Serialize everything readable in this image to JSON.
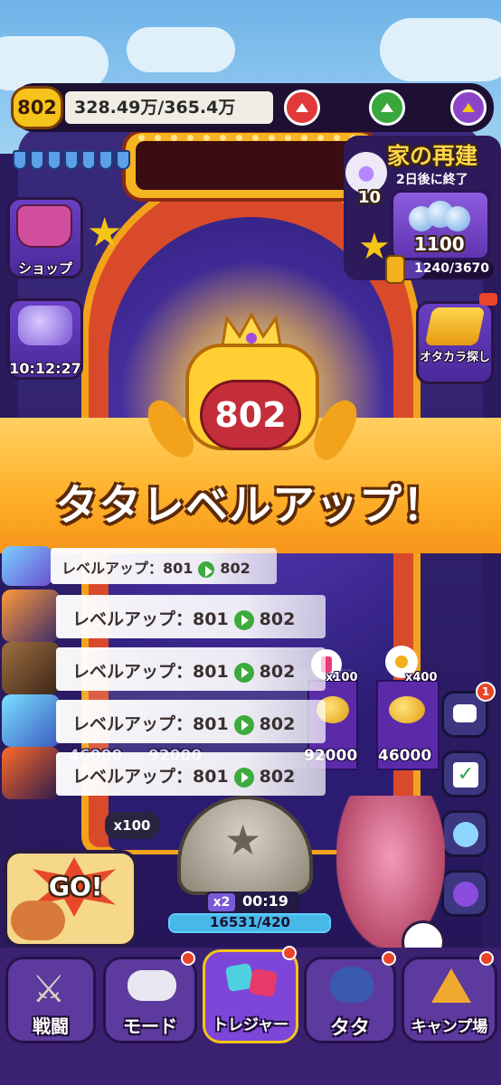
{
  "top_bar": {
    "player_level": "802",
    "exp": "328.49万/365.4万"
  },
  "event": {
    "title": "家の再建",
    "subtitle": "2日後に終了",
    "paw_count": "10",
    "reward_value": "1100",
    "progress": "1240/3670"
  },
  "left_buttons": {
    "shop_label": "ショップ",
    "timer": "10:12:27"
  },
  "right_buttons": {
    "treasure_label": "オタカラ探し"
  },
  "level_up": {
    "level": "802",
    "title": "タタレベルアップ！"
  },
  "notifications": [
    {
      "prefix": "レベルアップ：801",
      "to": "802"
    },
    {
      "prefix": "レベルアップ：801",
      "to": "802"
    },
    {
      "prefix": "レベルアップ：801",
      "to": "802"
    },
    {
      "prefix": "レベルアップ：801",
      "to": "802"
    },
    {
      "prefix": "レベルアップ：801",
      "to": "802"
    }
  ],
  "slots": {
    "left_val_1": "46000",
    "left_val_2": "92000",
    "slot3_val": "92000",
    "slot4_val": "46000",
    "slot3_mult": "x100",
    "slot4_mult": "x400"
  },
  "plunger": {
    "multiplier": "x100",
    "ball_mult": "x2",
    "timer": "00:19",
    "counter": "16531/420"
  },
  "go_label": "GO!",
  "chat_badge": "1",
  "bottom_nav": [
    {
      "label": "戦闘"
    },
    {
      "label": "モード"
    },
    {
      "label": "トレジャー"
    },
    {
      "label": "タタ"
    },
    {
      "label": "キャンプ場"
    }
  ],
  "colors": {
    "banner": "#ffb22b",
    "nav_bg": "#3b2270",
    "level_badge": "#f6c21c"
  }
}
